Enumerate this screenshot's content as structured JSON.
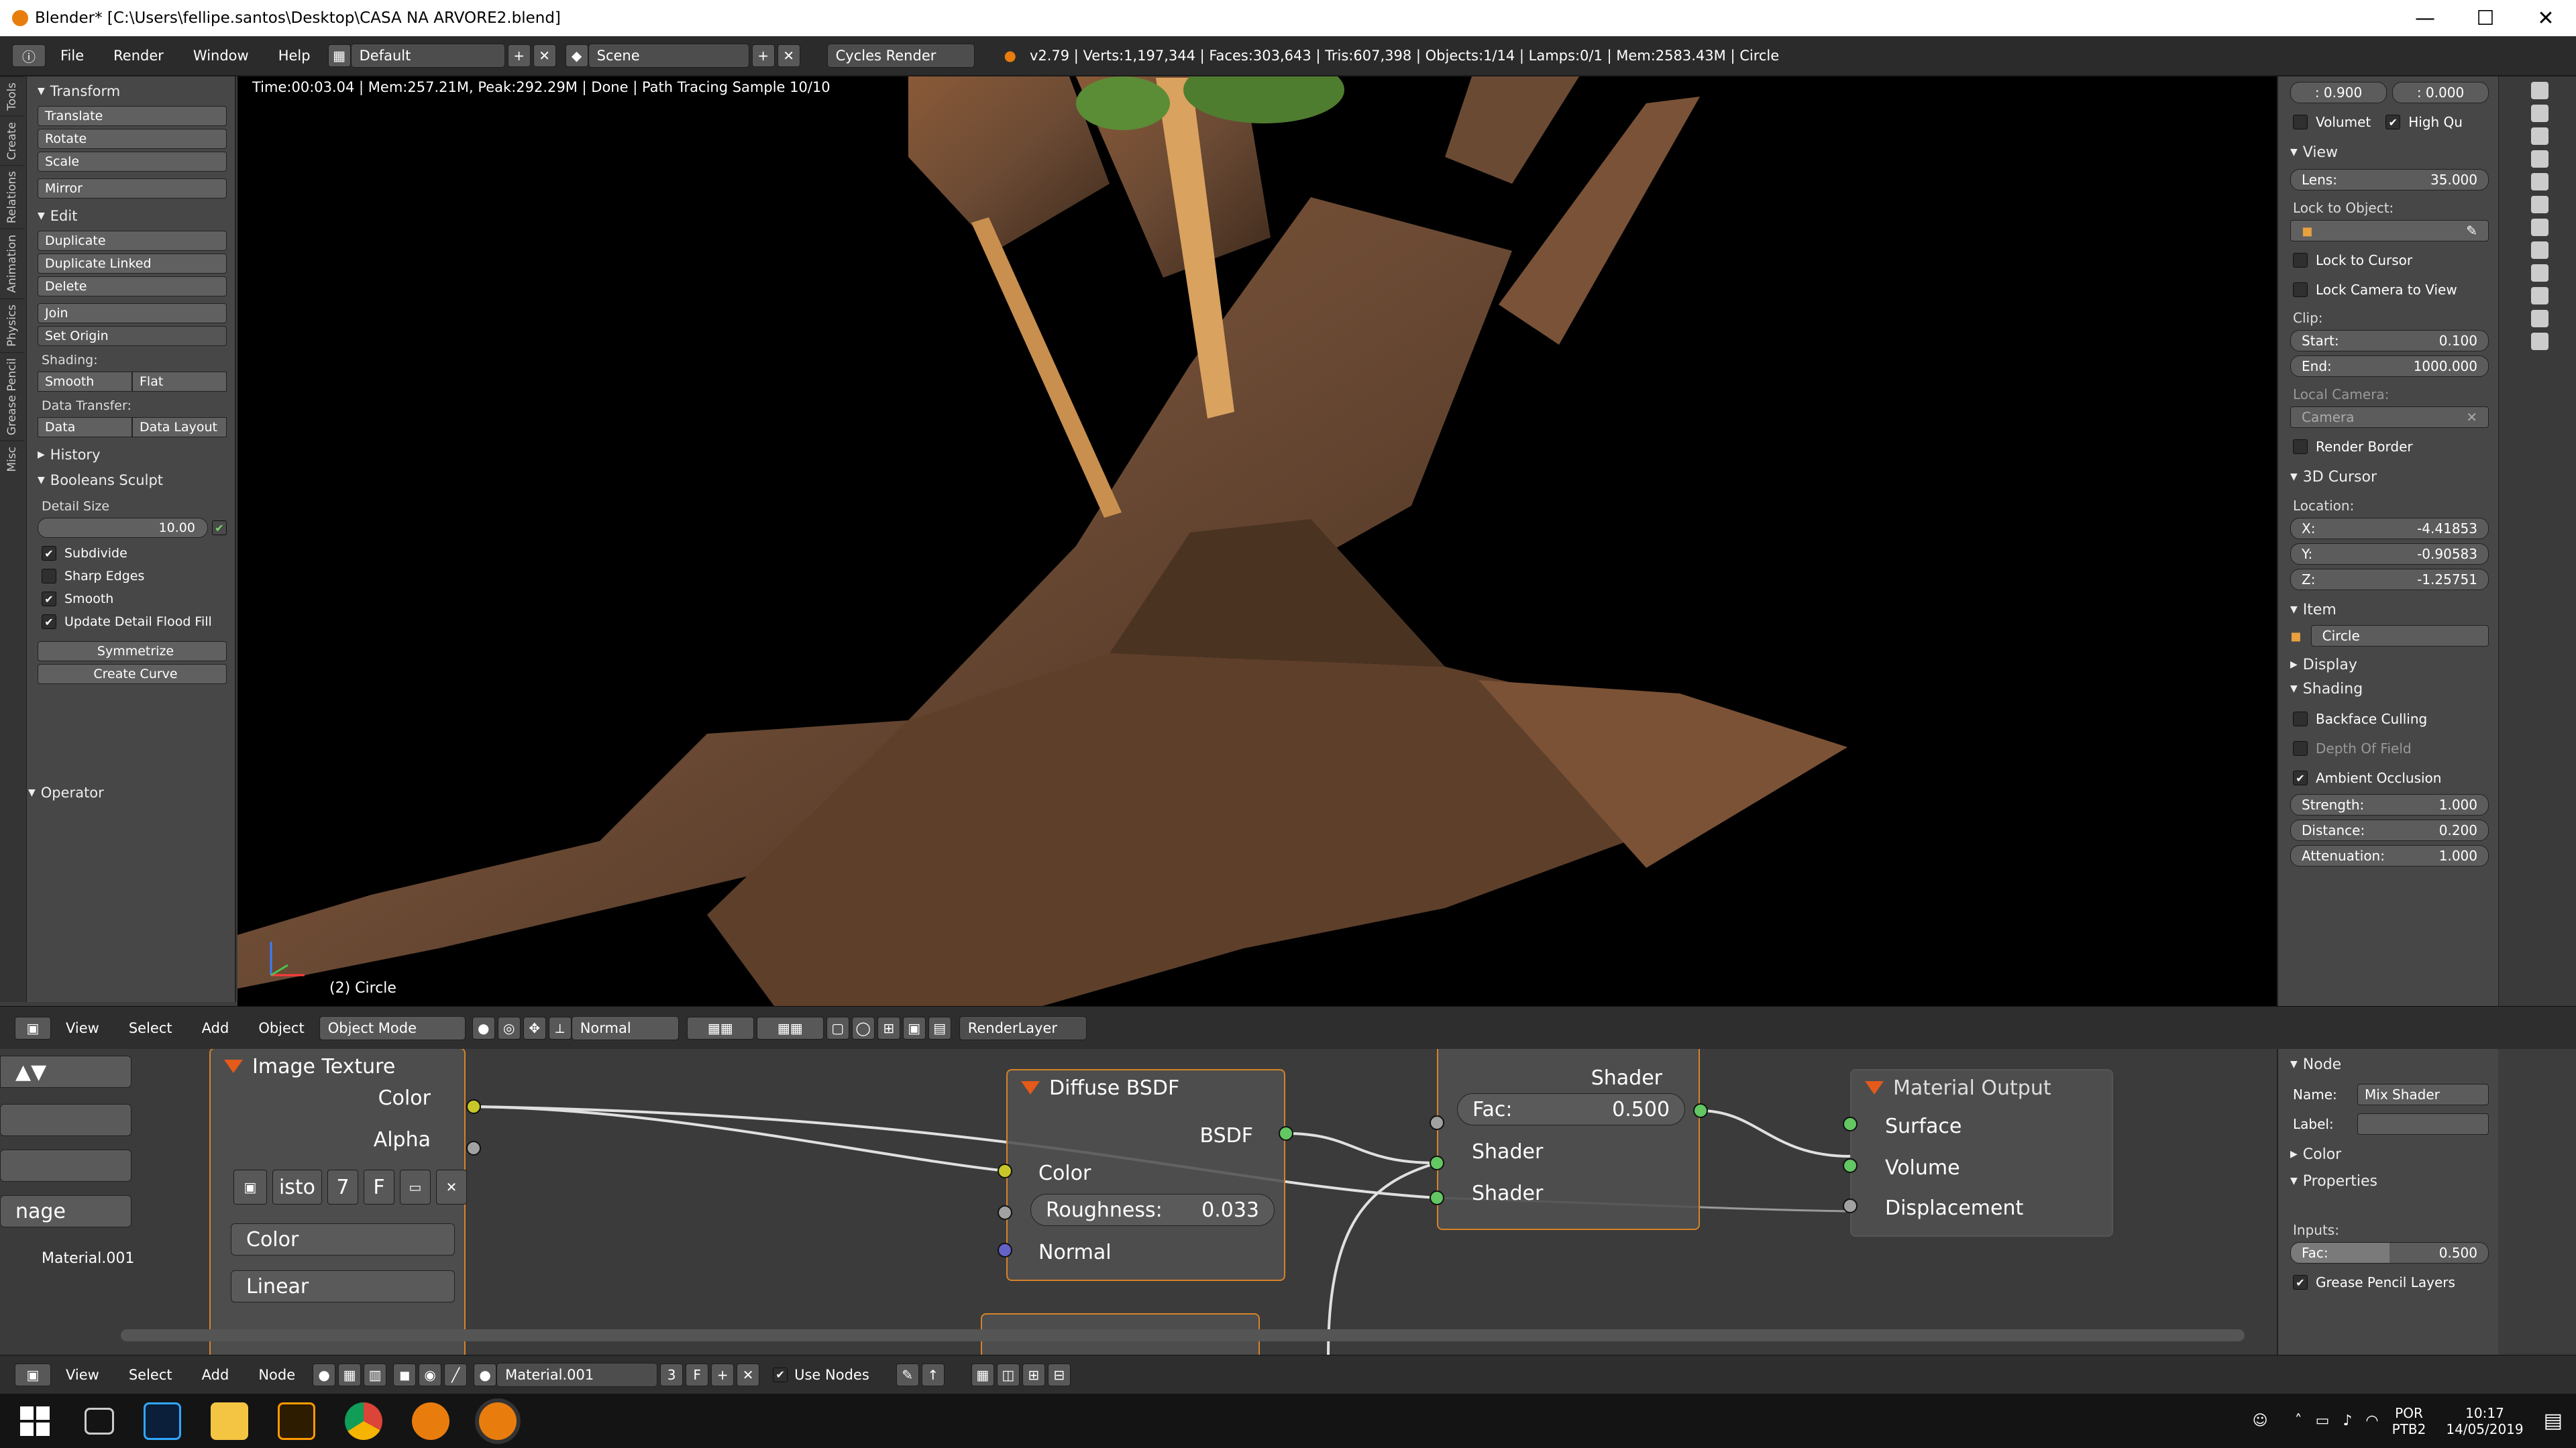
{
  "window": {
    "title": "Blender* [C:\\Users\\fellipe.santos\\Desktop\\CASA NA ARVORE2.blend]",
    "minimize": "—",
    "maximize": "☐",
    "close": "✕"
  },
  "infobar": {
    "menus": [
      "File",
      "Render",
      "Window",
      "Help"
    ],
    "layout": "Default",
    "scene": "Scene",
    "engine": "Cycles Render",
    "stats": "v2.79 | Verts:1,197,344 | Faces:303,643 | Tris:607,398 | Objects:1/14 | Lamps:0/1 | Mem:2583.43M | Circle"
  },
  "tool_tabs": [
    "Tools",
    "Create",
    "Relations",
    "Animation",
    "Physics",
    "Grease Pencil",
    "Misc"
  ],
  "tools": {
    "transform": {
      "header": "Transform",
      "buttons": [
        "Translate",
        "Rotate",
        "Scale"
      ],
      "mirror": "Mirror"
    },
    "edit": {
      "header": "Edit",
      "buttons": [
        "Duplicate",
        "Duplicate Linked",
        "Delete"
      ],
      "join": "Join",
      "set_origin": "Set Origin",
      "shading_label": "Shading:",
      "smooth": "Smooth",
      "flat": "Flat",
      "data_transfer_label": "Data Transfer:",
      "data": "Data",
      "data_layout": "Data Layout"
    },
    "history": "History",
    "booleans": {
      "header": "Booleans Sculpt",
      "detail_label": "Detail Size",
      "detail_value": "10.00",
      "checks": [
        {
          "label": "Subdivide",
          "on": true
        },
        {
          "label": "Sharp Edges",
          "on": false
        },
        {
          "label": "Smooth",
          "on": true
        },
        {
          "label": "Update Detail Flood Fill",
          "on": true
        }
      ],
      "symmetrize": "Symmetrize",
      "create_curve": "Create Curve"
    },
    "operator": "Operator"
  },
  "viewport": {
    "status": "Time:00:03.04 | Mem:257.21M, Peak:292.29M | Done | Path Tracing Sample 10/10",
    "object_label": "(2) Circle"
  },
  "rpanel": {
    "top_vals": [
      ": 0.900",
      ": 0.000"
    ],
    "volumet": "Volumet",
    "high_qu": "High Qu",
    "view": {
      "header": "View",
      "lens_label": "Lens:",
      "lens": "35.000",
      "lock_obj": "Lock to Object:",
      "lock_cursor": "Lock to Cursor",
      "lock_cam": "Lock Camera to View",
      "clip": "Clip:",
      "start_label": "Start:",
      "start": "0.100",
      "end_label": "End:",
      "end": "1000.000",
      "local_cam": "Local Camera:",
      "camera": "Camera",
      "render_border": "Render Border"
    },
    "cursor": {
      "header": "3D Cursor",
      "location": "Location:",
      "x_label": "X:",
      "x": "-4.41853",
      "y_label": "Y:",
      "y": "-0.90583",
      "z_label": "Z:",
      "z": "-1.25751"
    },
    "item": {
      "header": "Item",
      "name": "Circle"
    },
    "display": "Display",
    "shading": {
      "header": "Shading",
      "backface": "Backface Culling",
      "dof": "Depth Of Field",
      "ao": "Ambient Occlusion",
      "strength_label": "Strength:",
      "strength": "1.000",
      "distance_label": "Distance:",
      "distance": "0.200",
      "atten_label": "Attenuation:",
      "atten": "1.000"
    }
  },
  "vphead": {
    "view": "View",
    "select": "Select",
    "add": "Add",
    "object": "Object",
    "mode": "Object Mode",
    "orientation": "Normal",
    "renderlayer": "RenderLayer"
  },
  "nodes": {
    "image": {
      "title": "Image Texture",
      "color": "Color",
      "alpha": "Alpha",
      "img": "isto",
      "users": "7",
      "fake": "F",
      "cs": "Color",
      "interp": "Linear"
    },
    "left_sel": "nage",
    "material": "Material.001",
    "diffuse": {
      "title": "Diffuse BSDF",
      "bsdf": "BSDF",
      "color": "Color",
      "rough_label": "Roughness:",
      "rough": "0.033",
      "normal": "Normal"
    },
    "mix": {
      "shader_out": "Shader",
      "fac_label": "Fac:",
      "fac": "0.500",
      "shader1": "Shader",
      "shader2": "Shader"
    },
    "output": {
      "title": "Material Output",
      "surface": "Surface",
      "volume": "Volume",
      "displacement": "Displacement"
    }
  },
  "nprops": {
    "node": "Node",
    "name_label": "Name:",
    "name": "Mix Shader",
    "label_label": "Label:",
    "color": "Color",
    "properties": "Properties",
    "inputs": "Inputs:",
    "fac_label": "Fac:",
    "fac": "0.500",
    "gp": "Grease Pencil Layers"
  },
  "ndhead": {
    "view": "View",
    "select": "Select",
    "add": "Add",
    "node": "Node",
    "material": "Material.001",
    "users": "3",
    "fake": "F",
    "use_nodes": "Use Nodes"
  },
  "taskbar": {
    "lang": "POR",
    "layout": "PTB2",
    "time": "10:17",
    "date": "14/05/2019"
  }
}
